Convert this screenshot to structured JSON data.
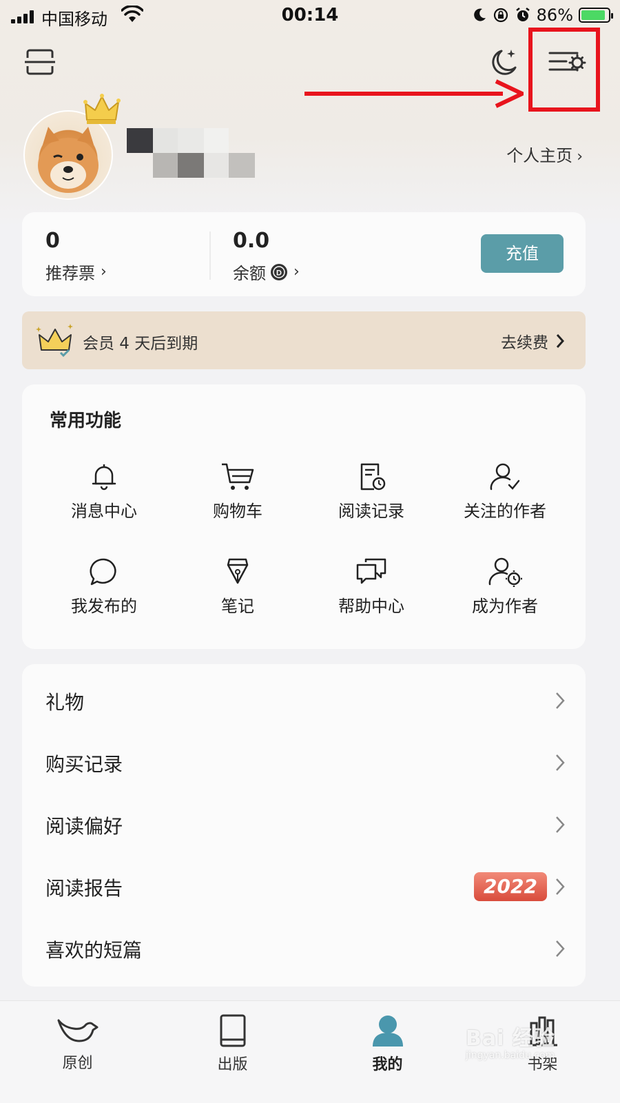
{
  "status_bar": {
    "carrier": "中国移动",
    "time": "00:14",
    "battery": "86%"
  },
  "profile": {
    "homepage_link": "个人主页"
  },
  "wallet": {
    "tickets_value": "0",
    "tickets_label": "推荐票",
    "balance_value": "0.0",
    "balance_label": "余额",
    "recharge_button": "充值"
  },
  "membership": {
    "expire_text": "会员 4 天后到期",
    "renew_label": "去续费"
  },
  "functions": {
    "title": "常用功能",
    "items": [
      {
        "label": "消息中心",
        "icon": "bell-icon"
      },
      {
        "label": "购物车",
        "icon": "cart-icon"
      },
      {
        "label": "阅读记录",
        "icon": "reading-history-icon"
      },
      {
        "label": "关注的作者",
        "icon": "followed-author-icon"
      },
      {
        "label": "我发布的",
        "icon": "chat-bubble-icon"
      },
      {
        "label": "笔记",
        "icon": "pen-nib-icon"
      },
      {
        "label": "帮助中心",
        "icon": "help-chat-icon"
      },
      {
        "label": "成为作者",
        "icon": "become-author-icon"
      }
    ]
  },
  "menu": {
    "items": [
      {
        "label": "礼物"
      },
      {
        "label": "购买记录"
      },
      {
        "label": "阅读偏好"
      },
      {
        "label": "阅读报告",
        "badge": "2022"
      },
      {
        "label": "喜欢的短篇"
      }
    ]
  },
  "tabbar": {
    "items": [
      {
        "label": "原创",
        "icon": "bird-icon"
      },
      {
        "label": "出版",
        "icon": "book-icon"
      },
      {
        "label": "我的",
        "icon": "person-icon",
        "active": true
      },
      {
        "label": "书架",
        "icon": "bookshelf-icon"
      }
    ]
  },
  "watermark": {
    "text": "Bai 经验",
    "sub": "jingyan.baidu.com"
  },
  "colors": {
    "accent": "#5b9da8",
    "highlight": "#e8141d",
    "vip_bg": "#ecdfcf"
  }
}
